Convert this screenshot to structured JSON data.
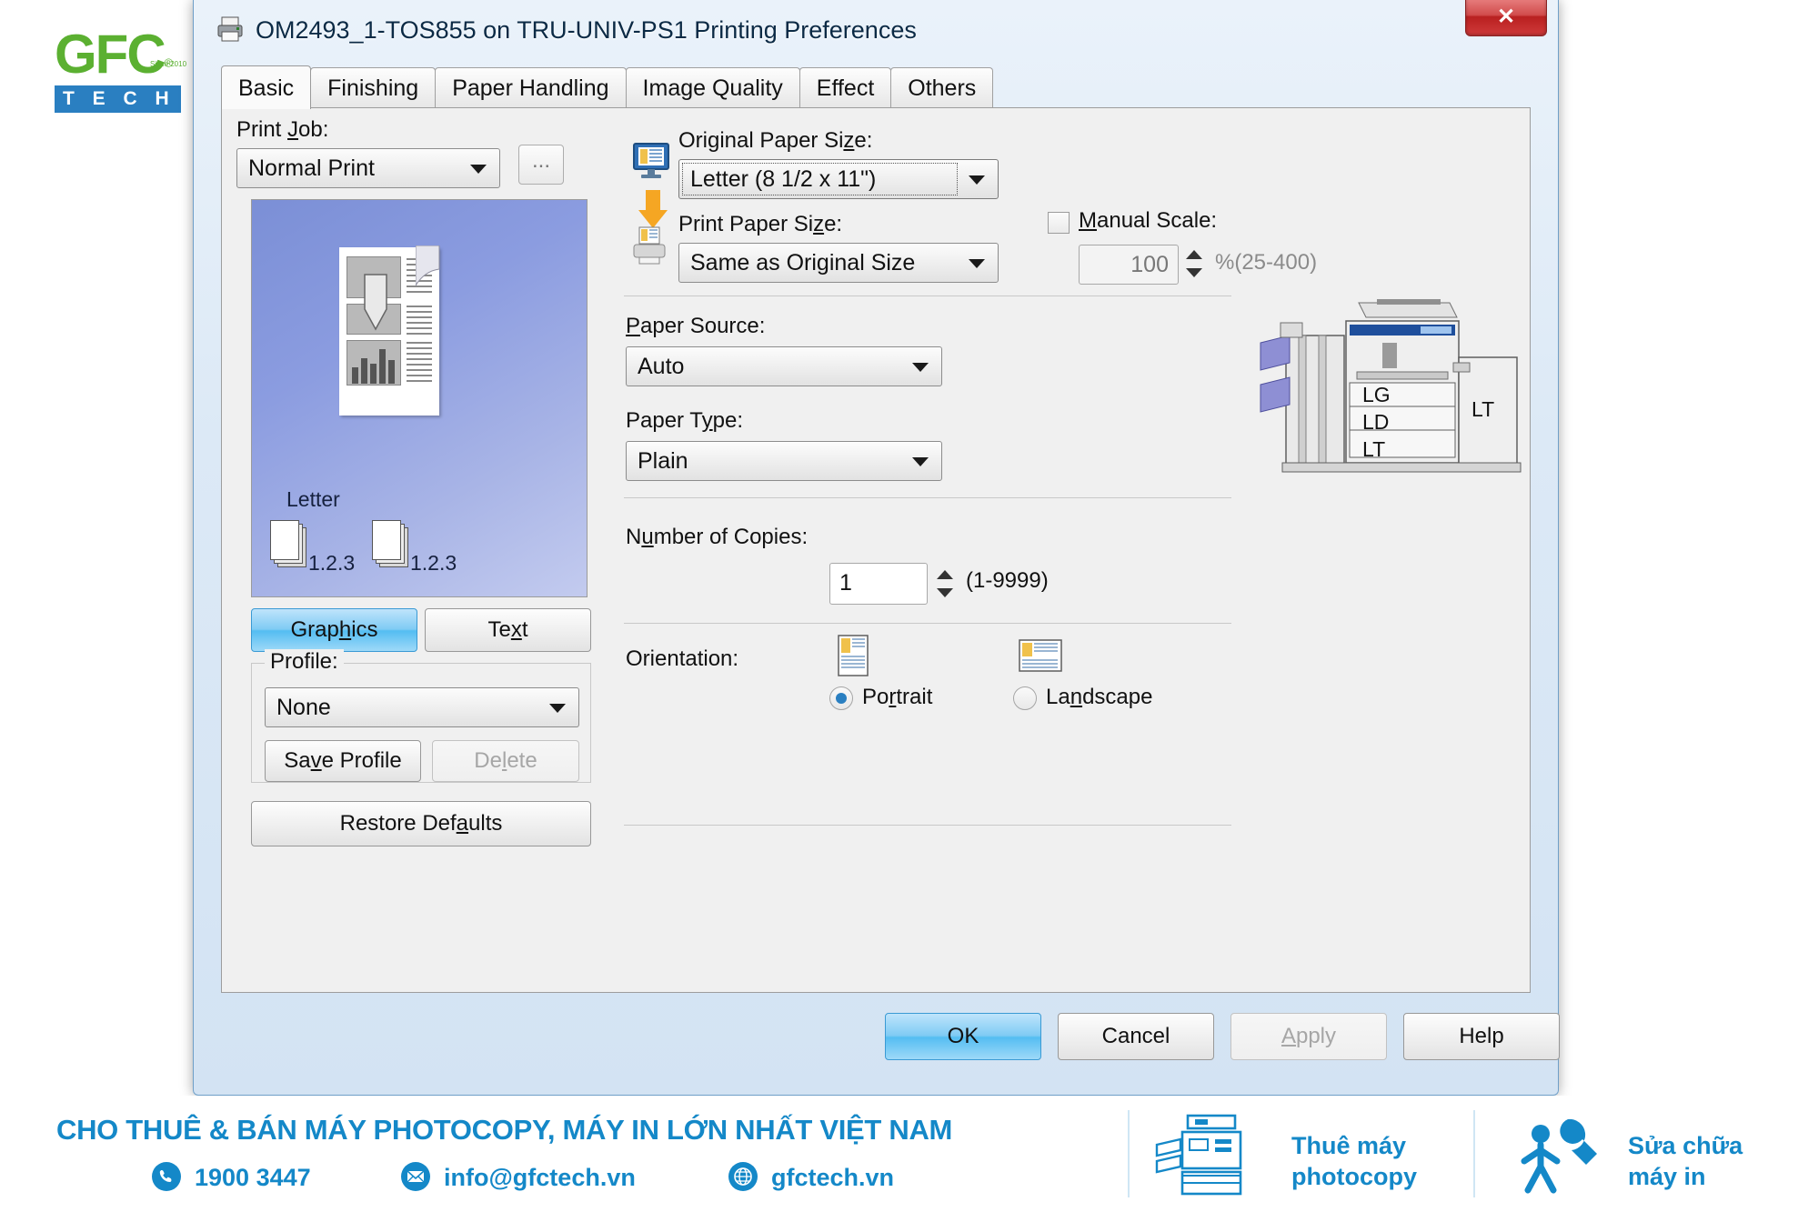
{
  "logo": {
    "name": "GFC",
    "registered": "®",
    "since": "Since 2010",
    "tech": "T E C H"
  },
  "window": {
    "title": "OM2493_1-TOS855 on TRU-UNIV-PS1 Printing Preferences",
    "printer_icon": "printer-icon",
    "close_label": "✕"
  },
  "tabs": [
    {
      "label": "Basic",
      "active": true
    },
    {
      "label": "Finishing",
      "active": false
    },
    {
      "label": "Paper Handling",
      "active": false
    },
    {
      "label": "Image Quality",
      "active": false
    },
    {
      "label": "Effect",
      "active": false
    },
    {
      "label": "Others",
      "active": false
    }
  ],
  "left": {
    "print_job_label": "Print Job:",
    "print_job_value": "Normal Print",
    "dots_button_label": "...",
    "preview_paper_label": "Letter",
    "stack_label_1": "1.2.3",
    "stack_label_2": "1.2.3",
    "graphics_button": "Graphics",
    "text_button": "Text",
    "profile_label": "Profile:",
    "profile_value": "None",
    "save_profile_button": "Save Profile",
    "delete_button": "Delete",
    "restore_defaults_button": "Restore Defaults"
  },
  "right": {
    "original_paper_size_label": "Original Paper Size:",
    "original_paper_size_value": "Letter (8 1/2 x 11\")",
    "print_paper_size_label": "Print Paper Size:",
    "print_paper_size_value": "Same as Original Size",
    "manual_scale_label": "Manual Scale:",
    "manual_scale_value": "100",
    "manual_scale_range": "%(25-400)",
    "paper_source_label": "Paper Source:",
    "paper_source_value": "Auto",
    "paper_type_label": "Paper Type:",
    "paper_type_value": "Plain",
    "number_of_copies_label": "Number of Copies:",
    "number_of_copies_value": "1",
    "number_of_copies_range": "(1-9999)",
    "orientation_label": "Orientation:",
    "orientation_portrait": "Portrait",
    "orientation_landscape": "Landscape",
    "tray_labels": [
      "LG",
      "LD",
      "LT",
      "LT"
    ]
  },
  "footer_buttons": {
    "ok": "OK",
    "cancel": "Cancel",
    "apply": "Apply",
    "help": "Help"
  },
  "banner": {
    "headline": "CHO THUÊ & BÁN MÁY PHOTOCOPY, MÁY IN LỚN NHẤT VIỆT NAM",
    "phone": "1900 3447",
    "email": "info@gfctech.vn",
    "website": "gfctech.vn",
    "service_1_line1": "Thuê máy",
    "service_1_line2": "photocopy",
    "service_2_line1": "Sửa chữa",
    "service_2_line2": "máy in"
  },
  "colors": {
    "brand_blue": "#1488c8",
    "brand_green": "#5bb031",
    "accent_orange": "#f5a623",
    "selected_blue": "#54bdf2",
    "title_text": "#0b2a45"
  }
}
